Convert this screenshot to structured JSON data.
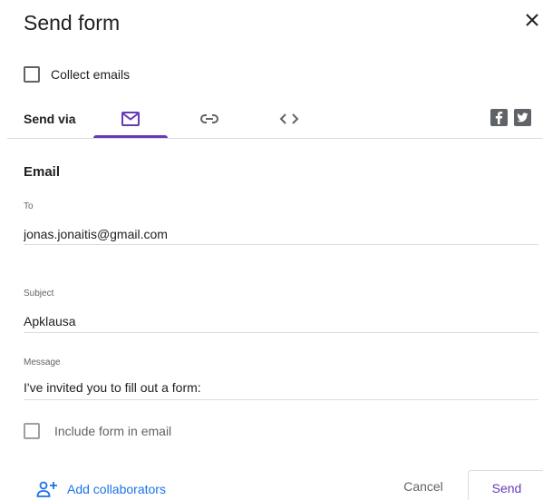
{
  "dialog": {
    "title": "Send form"
  },
  "collect_emails": {
    "label": "Collect emails",
    "checked": false
  },
  "send_via": {
    "label": "Send via",
    "active_tab": "email",
    "tabs": [
      {
        "id": "email",
        "icon": "mail-icon"
      },
      {
        "id": "link",
        "icon": "link-icon"
      },
      {
        "id": "embed",
        "icon": "code-embed-icon"
      }
    ],
    "social": [
      {
        "id": "facebook",
        "icon": "facebook-icon"
      },
      {
        "id": "twitter",
        "icon": "twitter-icon"
      }
    ]
  },
  "email_form": {
    "section_title": "Email",
    "to_label": "To",
    "to_value": "jonas.jonaitis@gmail.com",
    "subject_label": "Subject",
    "subject_value": "Apklausa",
    "message_label": "Message",
    "message_value": "I've invited you to fill out a form:",
    "include_label": "Include form in email",
    "include_checked": false
  },
  "footer": {
    "add_collaborators_label": "Add collaborators",
    "cancel_label": "Cancel",
    "send_label": "Send"
  },
  "colors": {
    "accent": "#673ab7",
    "link_blue": "#1a73e8",
    "divider": "#dadce0",
    "icon_gray": "#5f6368"
  }
}
